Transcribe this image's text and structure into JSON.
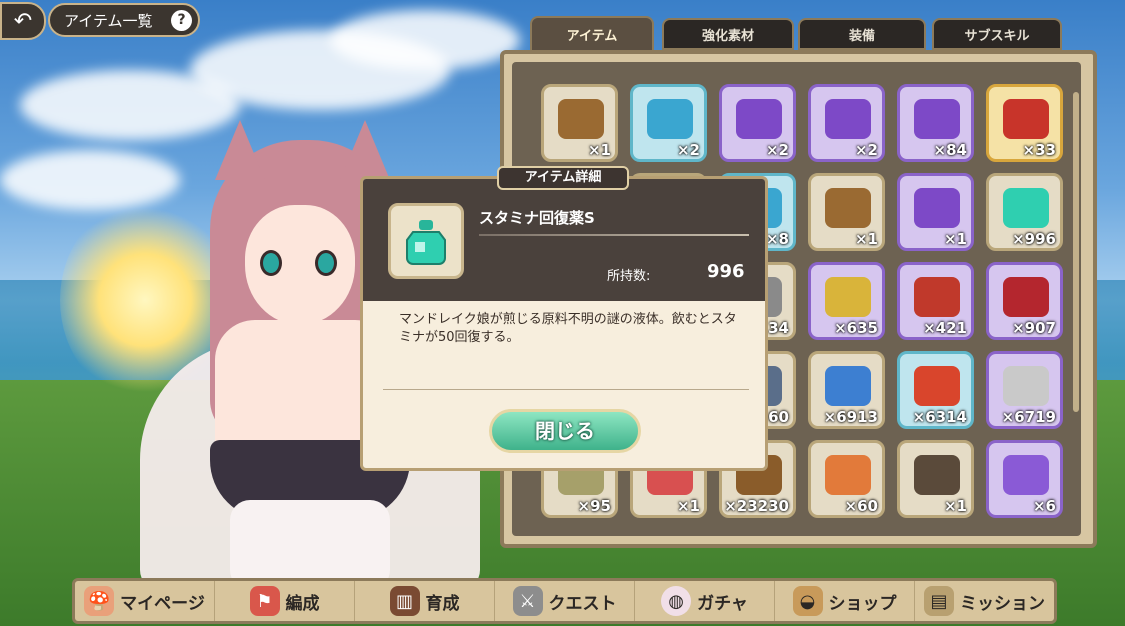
{
  "header": {
    "back_icon": "back-arrow-icon",
    "title": "アイテム一覧",
    "help_label": "?"
  },
  "tabs": [
    {
      "label": "アイテム",
      "active": true
    },
    {
      "label": "強化素材",
      "active": false
    },
    {
      "label": "装備",
      "active": false
    },
    {
      "label": "サブスキル",
      "active": false
    }
  ],
  "inventory": {
    "rows": [
      [
        {
          "icon": "bronze-chest-icon",
          "count": "×1",
          "frame": "plain"
        },
        {
          "icon": "blue-chest-icon",
          "count": "×2",
          "frame": "blue"
        },
        {
          "icon": "purple-chest-icon",
          "count": "×2",
          "frame": "purple"
        },
        {
          "icon": "purple-chest-icon",
          "count": "×2",
          "frame": "purple"
        },
        {
          "icon": "purple-chest-icon",
          "count": "×84",
          "frame": "purple"
        },
        {
          "icon": "red-chest-icon",
          "count": "×33",
          "frame": "gold"
        }
      ],
      [
        {
          "icon": "hidden",
          "count": "",
          "frame": "plain"
        },
        {
          "icon": "hidden",
          "count": "",
          "frame": "plain"
        },
        {
          "icon": "blue-chest-icon",
          "count": "×8",
          "frame": "blue"
        },
        {
          "icon": "bronze-chest-icon",
          "count": "×1",
          "frame": "plain"
        },
        {
          "icon": "purple-chest-icon",
          "count": "×1",
          "frame": "purple"
        },
        {
          "icon": "stamina-potion-icon",
          "count": "×996",
          "frame": "plain"
        }
      ],
      [
        {
          "icon": "hidden",
          "count": "",
          "frame": "plain"
        },
        {
          "icon": "hidden",
          "count": "",
          "frame": "plain"
        },
        {
          "icon": "gear-icon",
          "count": "34",
          "frame": "plain"
        },
        {
          "icon": "gold-key-icon",
          "count": "×635",
          "frame": "purple"
        },
        {
          "icon": "red-ticket-icon",
          "count": "×421",
          "frame": "purple"
        },
        {
          "icon": "red-key-icon",
          "count": "×907",
          "frame": "purple"
        }
      ],
      [
        {
          "icon": "hidden",
          "count": "",
          "frame": "plain"
        },
        {
          "icon": "hidden",
          "count": "",
          "frame": "plain"
        },
        {
          "icon": "book-icon",
          "count": "60",
          "frame": "plain"
        },
        {
          "icon": "exp-milk-blue-icon",
          "count": "×6913",
          "frame": "plain"
        },
        {
          "icon": "exp-milk-red-icon",
          "count": "×6314",
          "frame": "blue"
        },
        {
          "icon": "exp-can-icon",
          "count": "×6719",
          "frame": "purple"
        }
      ],
      [
        {
          "icon": "lantern-icon",
          "count": "×95",
          "frame": "plain"
        },
        {
          "icon": "red-coin-icon",
          "count": "×1",
          "frame": "plain"
        },
        {
          "icon": "film-icon",
          "count": "×23230",
          "frame": "plain"
        },
        {
          "icon": "balloon-icon",
          "count": "×60",
          "frame": "plain"
        },
        {
          "icon": "scroll-icon",
          "count": "×1",
          "frame": "plain"
        },
        {
          "icon": "purple-bag-icon",
          "count": "×6",
          "frame": "purple"
        }
      ]
    ]
  },
  "modal": {
    "label": "アイテム詳細",
    "item_name": "スタミナ回復薬S",
    "item_icon": "stamina-potion-icon",
    "owned_label": "所持数:",
    "owned_value": "996",
    "description": "マンドレイク娘が煎じる原料不明の謎の液体。飲むとスタミナが50回復する。",
    "close_label": "閉じる"
  },
  "nav": [
    {
      "label": "マイページ",
      "icon": "mushroom-house-icon"
    },
    {
      "label": "編成",
      "icon": "flag-icon"
    },
    {
      "label": "育成",
      "icon": "book-icon"
    },
    {
      "label": "クエスト",
      "icon": "crossed-swords-icon"
    },
    {
      "label": "ガチャ",
      "icon": "egg-icon"
    },
    {
      "label": "ショップ",
      "icon": "bag-icon"
    },
    {
      "label": "ミッション",
      "icon": "map-scroll-icon"
    }
  ],
  "colors": {
    "panel_dark": "#4a413c",
    "accent_green": "#3fb28b",
    "frame_gold": "#c9b38a"
  }
}
